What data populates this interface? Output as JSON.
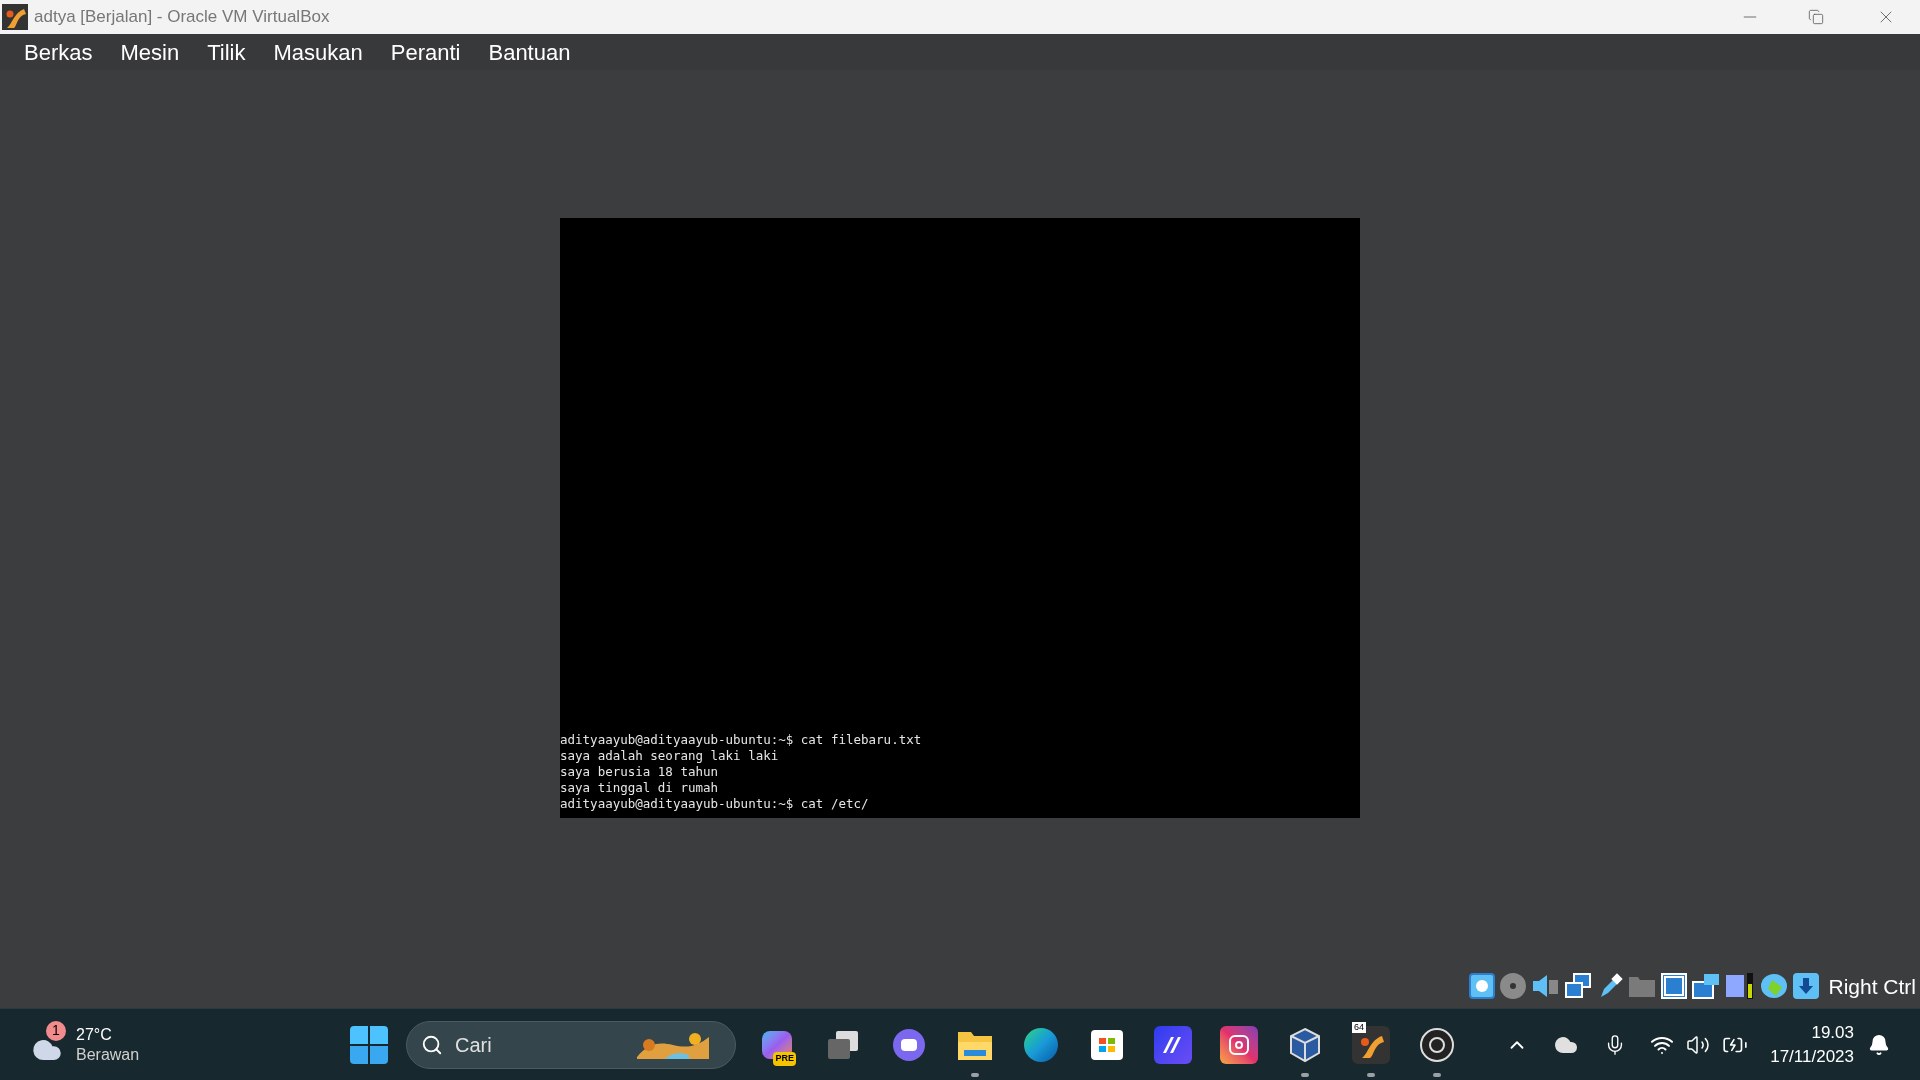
{
  "window": {
    "title": "adtya [Berjalan] - Oracle VM VirtualBox"
  },
  "menu": [
    "Berkas",
    "Mesin",
    "Tilik",
    "Masukan",
    "Peranti",
    "Bantuan"
  ],
  "terminal": {
    "lines": [
      "adityaayub@adityaayub-ubuntu:~$ cat filebaru.txt",
      "saya adalah seorang laki laki",
      "saya berusia 18 tahun",
      "saya tinggal di rumah",
      "adityaayub@adityaayub-ubuntu:~$ cat /etc/"
    ]
  },
  "status_bar": {
    "icons": [
      {
        "kind": "hdd"
      },
      {
        "kind": "optical"
      },
      {
        "kind": "audio"
      },
      {
        "kind": "network"
      },
      {
        "kind": "usb"
      },
      {
        "kind": "shared"
      },
      {
        "kind": "display"
      },
      {
        "kind": "recording"
      },
      {
        "kind": "cpu"
      },
      {
        "kind": "mouse"
      },
      {
        "kind": "download"
      }
    ],
    "host_key": "Right Ctrl"
  },
  "taskbar": {
    "weather": {
      "badge": "1",
      "temperature": "27°C",
      "condition": "Berawan"
    },
    "search": {
      "placeholder": "Cari"
    },
    "apps": [
      {
        "kind": "copilot",
        "badge": "PRE",
        "running": false
      },
      {
        "kind": "taskview",
        "running": false
      },
      {
        "kind": "meet",
        "running": false
      },
      {
        "kind": "explorer",
        "running": true
      },
      {
        "kind": "edge",
        "running": false
      },
      {
        "kind": "store",
        "running": false
      },
      {
        "kind": "editor",
        "running": false
      },
      {
        "kind": "instagram",
        "running": false
      },
      {
        "kind": "cube",
        "running": true
      },
      {
        "kind": "virtualbox",
        "badge": "64",
        "running": true
      },
      {
        "kind": "obs",
        "running": true
      }
    ],
    "clock": {
      "time": "19.03",
      "date": "17/11/2023"
    }
  }
}
